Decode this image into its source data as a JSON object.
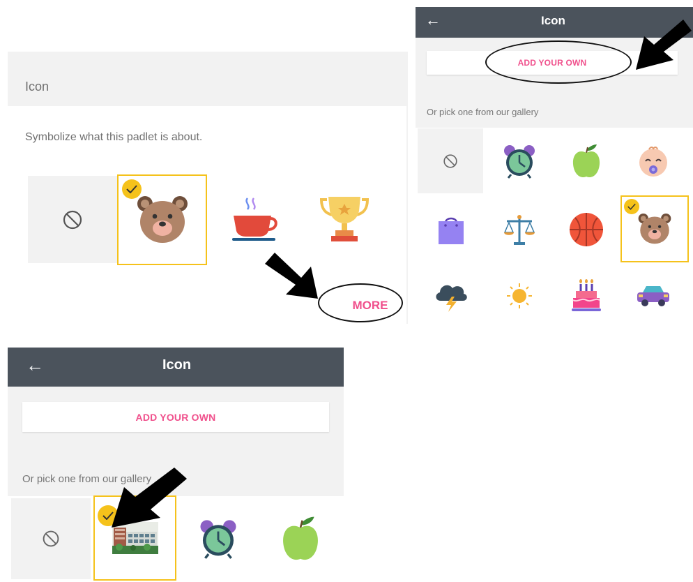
{
  "panel_a": {
    "section_title": "Icon",
    "description": "Symbolize what this padlet is about.",
    "more_label": "MORE"
  },
  "panel_b": {
    "title": "Icon",
    "add_label": "ADD YOUR OWN",
    "gallery_label": "Or pick one from our gallery"
  },
  "panel_c": {
    "title": "Icon",
    "add_label": "ADD YOUR OWN",
    "gallery_label": "Or pick one from our gallery"
  },
  "colors": {
    "accent_pink": "#f0508c",
    "selected_yellow": "#f5c21b",
    "topbar": "#4b535c",
    "grey_bg": "#f2f2f2"
  },
  "icons": {
    "panel_a_row": [
      "none-icon",
      "bear-icon",
      "coffee-cup-icon",
      "trophy-icon"
    ],
    "panel_b_grid": [
      "none-icon",
      "alarm-clock-icon",
      "apple-icon",
      "baby-icon",
      "shopping-bag-icon",
      "scales-icon",
      "basketball-icon",
      "bear-icon",
      "storm-cloud-icon",
      "sun-icon",
      "birthday-cake-icon",
      "car-icon"
    ],
    "panel_c_row": [
      "none-icon",
      "custom-building-photo-icon",
      "alarm-clock-icon",
      "apple-icon"
    ]
  },
  "selected": {
    "panel_a": "bear-icon",
    "panel_b": "bear-icon",
    "panel_c": "custom-building-photo-icon"
  }
}
